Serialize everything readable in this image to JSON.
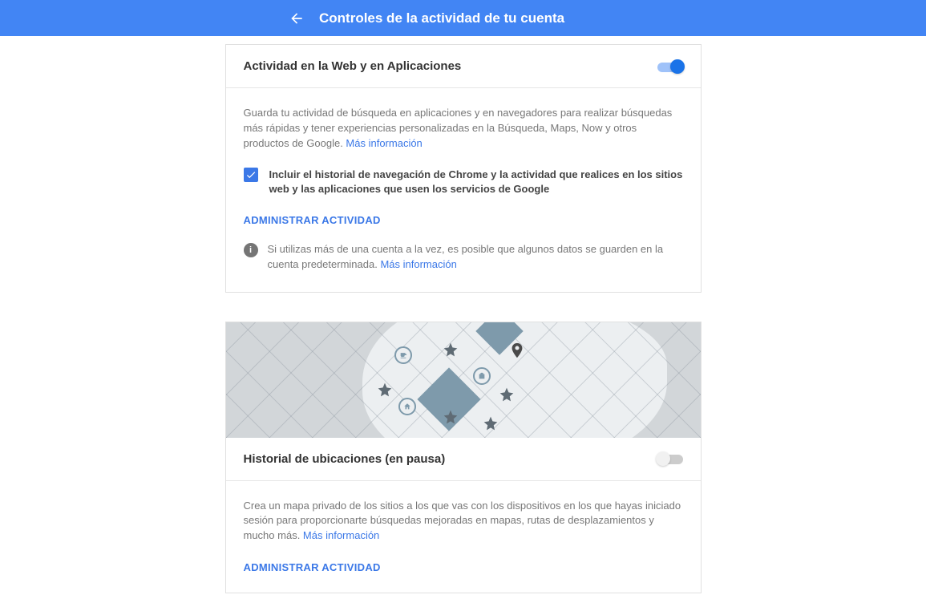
{
  "header": {
    "title": "Controles de la actividad de tu cuenta"
  },
  "cards": {
    "web": {
      "title": "Actividad en la Web y en Aplicaciones",
      "toggle_on": true,
      "description": "Guarda tu actividad de búsqueda en aplicaciones y en navegadores para realizar búsquedas más rápidas y tener experiencias personalizadas en la Búsqueda, Maps, Now y otros productos de Google. ",
      "more_info": "Más información",
      "checkbox_label": "Incluir el historial de navegación de Chrome y la actividad que realices en los sitios web y las aplicaciones que usen los servicios de Google",
      "checkbox_checked": true,
      "manage": "ADMINISTRAR ACTIVIDAD",
      "note": "Si utilizas más de una cuenta a la vez, es posible que algunos datos se guarden en la cuenta predeterminada. ",
      "note_link": "Más información"
    },
    "location": {
      "title": "Historial de ubicaciones (en pausa)",
      "toggle_on": false,
      "description": "Crea un mapa privado de los sitios a los que vas con los dispositivos en los que hayas iniciado sesión para proporcionarte búsquedas mejoradas en mapas, rutas de desplazamientos y mucho más. ",
      "more_info": "Más información",
      "manage": "ADMINISTRAR ACTIVIDAD"
    }
  }
}
